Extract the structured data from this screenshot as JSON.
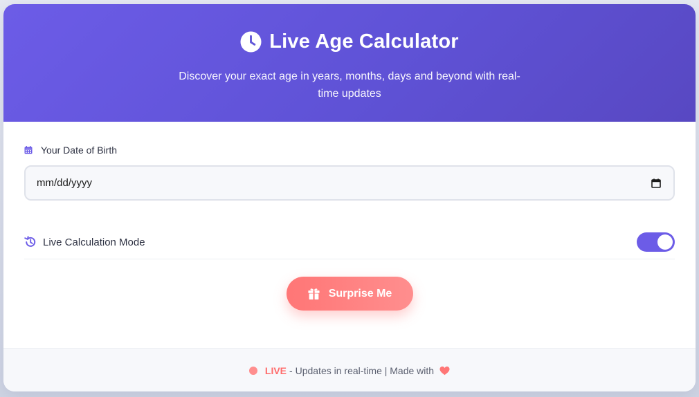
{
  "header": {
    "title": "Live Age Calculator",
    "subtitle": "Discover your exact age in years, months, days and beyond with real-time updates",
    "icon": "clock-icon"
  },
  "birth_date": {
    "label": "Your Date of Birth",
    "label_icon": "calendar-icon",
    "value": "mm/dd/yyyy",
    "picker_icon": "calendar-picker-icon"
  },
  "live_mode": {
    "label": "Live Calculation Mode",
    "icon": "history-icon",
    "enabled": true
  },
  "surprise_button": {
    "label": "Surprise Me",
    "icon": "gift-icon"
  },
  "footer": {
    "live_word": "LIVE",
    "text": "- Updates in real-time | Made with",
    "icon": "heart-icon"
  },
  "colors": {
    "primary": "#6c5ce7",
    "accent": "#ff7676",
    "text": "#2d3142"
  }
}
